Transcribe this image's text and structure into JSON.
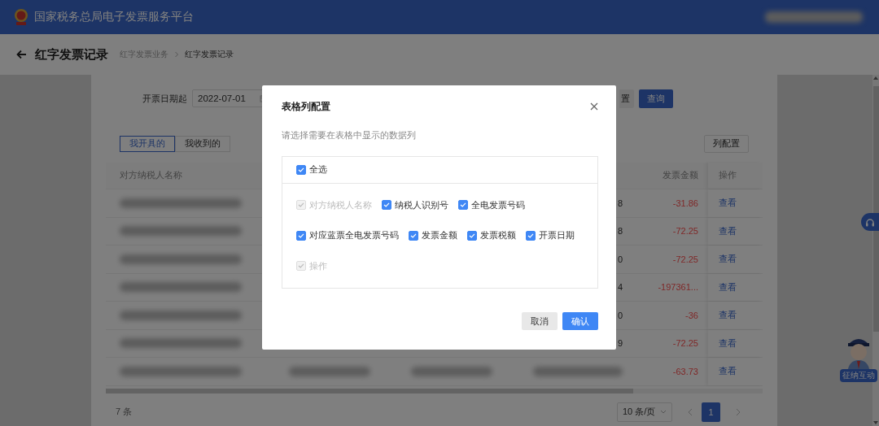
{
  "header": {
    "title": "国家税务总局电子发票服务平台"
  },
  "page": {
    "title": "红字发票记录",
    "breadcrumb": [
      {
        "label": "红字发票业务",
        "current": false
      },
      {
        "label": "红字发票记录",
        "current": true
      }
    ]
  },
  "filters": {
    "date_from": {
      "label": "开票日期起",
      "value": "2022-07-01"
    },
    "buttons": [
      {
        "label": "置",
        "kind": "secondary"
      },
      {
        "label": "查询",
        "kind": "primary"
      }
    ]
  },
  "tabs": [
    {
      "label": "我开具的",
      "selected": true
    },
    {
      "label": "我收到的",
      "selected": false
    }
  ],
  "column_config_button": "列配置",
  "table": {
    "columns": [
      {
        "label": "对方纳税人名称"
      },
      {
        "label": "发票金额"
      },
      {
        "label": "操作"
      }
    ],
    "rows": [
      {
        "column_4": "8",
        "amount": "-31.86",
        "action": "查看"
      },
      {
        "column_4": "8",
        "amount": "-72.25",
        "action": "查看"
      },
      {
        "column_4": "0",
        "amount": "-72.25",
        "action": "查看"
      },
      {
        "column_4": "4",
        "amount": "-197361...",
        "action": "查看"
      },
      {
        "column_4": "0",
        "amount": "-36",
        "action": "查看"
      },
      {
        "column_4": "9",
        "amount": "-72.25",
        "action": "查看"
      },
      {
        "amount": "-63.73",
        "action": "查看"
      }
    ]
  },
  "pagination": {
    "total": "7 条",
    "page_size": "10 条/页",
    "pages": [
      {
        "label": "1",
        "selected": true
      }
    ]
  },
  "support": {
    "label": "征纳互动"
  },
  "dialog": {
    "title": "表格列配置",
    "hint": "请选择需要在表格中显示的数据列",
    "select_all": {
      "label": "全选",
      "checked": true
    },
    "option_rows": [
      {
        "options": [
          {
            "label": "对方纳税人名称",
            "checked": true,
            "disabled": true
          },
          {
            "label": "纳税人识别号",
            "checked": true,
            "disabled": false
          },
          {
            "label": "全电发票号码",
            "checked": true,
            "disabled": false
          }
        ]
      },
      {
        "options": [
          {
            "label": "对应蓝票全电发票号码",
            "checked": true,
            "disabled": false
          },
          {
            "label": "发票金额",
            "checked": true,
            "disabled": false
          },
          {
            "label": "发票税额",
            "checked": true,
            "disabled": false
          },
          {
            "label": "开票日期",
            "checked": true,
            "disabled": false
          }
        ]
      },
      {
        "options": [
          {
            "label": "操作",
            "checked": true,
            "disabled": true
          }
        ]
      }
    ],
    "buttons": [
      {
        "label": "取消",
        "kind": "secondary"
      },
      {
        "label": "确认",
        "kind": "primary"
      }
    ]
  }
}
